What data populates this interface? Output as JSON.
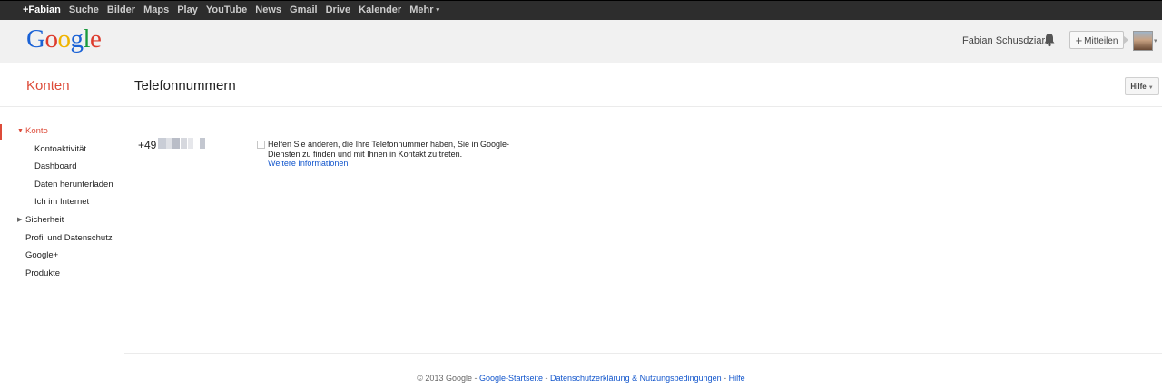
{
  "topbar": {
    "items": [
      "+Fabian",
      "Suche",
      "Bilder",
      "Maps",
      "Play",
      "YouTube",
      "News",
      "Gmail",
      "Drive",
      "Kalender",
      "Mehr"
    ],
    "more_caret": "▾"
  },
  "header": {
    "logo_letters": [
      "G",
      "o",
      "o",
      "g",
      "l",
      "e"
    ],
    "user_name": "Fabian Schusdziara",
    "share_label": "Mitteilen",
    "share_plus": "+"
  },
  "section": {
    "title": "Konten",
    "page_title": "Telefonnummern",
    "help_label": "Hilfe"
  },
  "sidebar": {
    "items": [
      {
        "label": "Konto",
        "level": "top",
        "active": true,
        "expanded": true
      },
      {
        "label": "Kontoaktivität",
        "level": "sub"
      },
      {
        "label": "Dashboard",
        "level": "sub"
      },
      {
        "label": "Daten herunterladen",
        "level": "sub"
      },
      {
        "label": "Ich im Internet",
        "level": "sub"
      },
      {
        "label": "Sicherheit",
        "level": "top",
        "collapsed": true
      },
      {
        "label": "Profil und Datenschutz",
        "level": "top"
      },
      {
        "label": "Google+",
        "level": "top"
      },
      {
        "label": "Produkte",
        "level": "top"
      }
    ]
  },
  "main": {
    "phone_prefix": "+49",
    "help_text": "Helfen Sie anderen, die Ihre Telefonnummer haben, Sie in Google-Diensten zu finden und mit Ihnen in Kontakt zu treten.",
    "more_info_link": "Weitere Informationen"
  },
  "footer": {
    "copyright": "© 2013 Google",
    "separator": " - ",
    "links": [
      "Google-Startseite",
      "Datenschutzerklärung & Nutzungsbedingungen",
      "Hilfe"
    ]
  },
  "colors": {
    "accent_red": "#dd4b39",
    "link_blue": "#1155cc",
    "topbar_bg": "#2d2d2d"
  }
}
